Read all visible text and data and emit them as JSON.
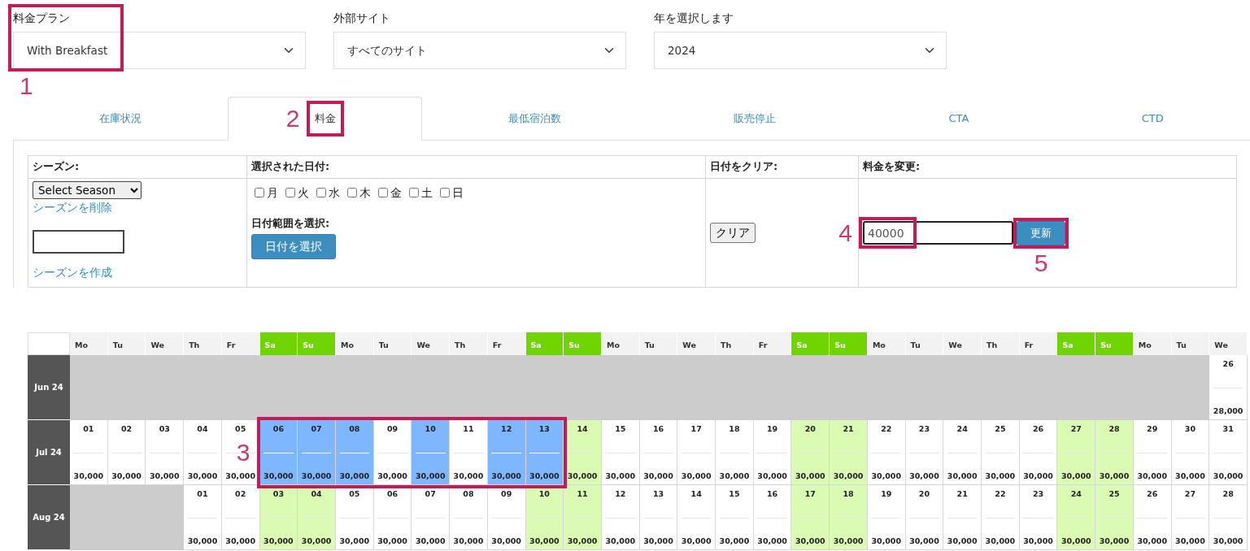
{
  "filters": [
    {
      "label": "料金プラン",
      "value": "With Breakfast"
    },
    {
      "label": "外部サイト",
      "value": "すべてのサイト"
    },
    {
      "label": "年を選択します",
      "value": "2024"
    }
  ],
  "tabs": [
    {
      "label": "在庫状況",
      "selected": false
    },
    {
      "label": "料金",
      "selected": true
    },
    {
      "label": "最低宿泊数",
      "selected": false
    },
    {
      "label": "販売停止",
      "selected": false
    },
    {
      "label": "CTA",
      "selected": false
    },
    {
      "label": "CTD",
      "selected": false
    }
  ],
  "season": {
    "heading": "シーズン:",
    "select": "Select Season",
    "delete_link": "シーズンを削除",
    "create_link": "シーズンを作成"
  },
  "dates": {
    "heading": "選択された日付:",
    "weekdays": [
      {
        "label": "月",
        "checked": false
      },
      {
        "label": "火",
        "checked": false
      },
      {
        "label": "水",
        "checked": false
      },
      {
        "label": "木",
        "checked": false
      },
      {
        "label": "金",
        "checked": false
      },
      {
        "label": "土",
        "checked": false
      },
      {
        "label": "日",
        "checked": false
      }
    ],
    "range_label": "日付範囲を選択:",
    "range_button": "日付を選択"
  },
  "clear": {
    "heading": "日付をクリア:",
    "button": "クリア"
  },
  "price": {
    "heading": "料金を変更:",
    "value": "40000",
    "button": "更新"
  },
  "calendar": {
    "weekdays": [
      {
        "label": "Mo",
        "weekend": false
      },
      {
        "label": "Tu",
        "weekend": false
      },
      {
        "label": "We",
        "weekend": false
      },
      {
        "label": "Th",
        "weekend": false
      },
      {
        "label": "Fr",
        "weekend": false
      },
      {
        "label": "Sa",
        "weekend": true
      },
      {
        "label": "Su",
        "weekend": true
      },
      {
        "label": "Mo",
        "weekend": false
      },
      {
        "label": "Tu",
        "weekend": false
      },
      {
        "label": "We",
        "weekend": false
      },
      {
        "label": "Th",
        "weekend": false
      },
      {
        "label": "Fr",
        "weekend": false
      },
      {
        "label": "Sa",
        "weekend": true
      },
      {
        "label": "Su",
        "weekend": true
      },
      {
        "label": "Mo",
        "weekend": false
      },
      {
        "label": "Tu",
        "weekend": false
      },
      {
        "label": "We",
        "weekend": false
      },
      {
        "label": "Th",
        "weekend": false
      },
      {
        "label": "Fr",
        "weekend": false
      },
      {
        "label": "Sa",
        "weekend": true
      },
      {
        "label": "Su",
        "weekend": true
      },
      {
        "label": "Mo",
        "weekend": false
      },
      {
        "label": "Tu",
        "weekend": false
      },
      {
        "label": "We",
        "weekend": false
      },
      {
        "label": "Th",
        "weekend": false
      },
      {
        "label": "Fr",
        "weekend": false
      },
      {
        "label": "Sa",
        "weekend": true
      },
      {
        "label": "Su",
        "weekend": true
      },
      {
        "label": "Mo",
        "weekend": false
      },
      {
        "label": "Tu",
        "weekend": false
      },
      {
        "label": "We",
        "weekend": false
      }
    ],
    "months": [
      {
        "label": "Jun 24",
        "cells": [
          {
            "kind": "blank"
          },
          {
            "kind": "blank"
          },
          {
            "kind": "blank"
          },
          {
            "kind": "blank"
          },
          {
            "kind": "blank"
          },
          {
            "kind": "blank"
          },
          {
            "kind": "blank"
          },
          {
            "kind": "blank"
          },
          {
            "kind": "blank"
          },
          {
            "kind": "blank"
          },
          {
            "kind": "blank"
          },
          {
            "kind": "blank"
          },
          {
            "kind": "blank"
          },
          {
            "kind": "blank"
          },
          {
            "kind": "blank"
          },
          {
            "kind": "blank"
          },
          {
            "kind": "blank"
          },
          {
            "kind": "blank"
          },
          {
            "kind": "blank"
          },
          {
            "kind": "blank"
          },
          {
            "kind": "blank"
          },
          {
            "kind": "blank"
          },
          {
            "kind": "blank"
          },
          {
            "kind": "blank"
          },
          {
            "kind": "blank"
          },
          {
            "kind": "blank"
          },
          {
            "kind": "blank"
          },
          {
            "kind": "blank"
          },
          {
            "kind": "blank"
          },
          {
            "kind": "blank"
          },
          {
            "kind": "day",
            "day": "26",
            "price": "28,000",
            "weekend": false,
            "selected": false
          }
        ]
      },
      {
        "label": "Jul 24",
        "cells": [
          {
            "kind": "day",
            "day": "01",
            "price": "30,000",
            "weekend": false,
            "selected": false
          },
          {
            "kind": "day",
            "day": "02",
            "price": "30,000",
            "weekend": false,
            "selected": false
          },
          {
            "kind": "day",
            "day": "03",
            "price": "30,000",
            "weekend": false,
            "selected": false
          },
          {
            "kind": "day",
            "day": "04",
            "price": "30,000",
            "weekend": false,
            "selected": false
          },
          {
            "kind": "day",
            "day": "05",
            "price": "30,000",
            "weekend": false,
            "selected": false
          },
          {
            "kind": "day",
            "day": "06",
            "price": "30,000",
            "weekend": true,
            "selected": true
          },
          {
            "kind": "day",
            "day": "07",
            "price": "30,000",
            "weekend": true,
            "selected": true
          },
          {
            "kind": "day",
            "day": "08",
            "price": "30,000",
            "weekend": false,
            "selected": true
          },
          {
            "kind": "day",
            "day": "09",
            "price": "30,000",
            "weekend": false,
            "selected": false
          },
          {
            "kind": "day",
            "day": "10",
            "price": "30,000",
            "weekend": false,
            "selected": true
          },
          {
            "kind": "day",
            "day": "11",
            "price": "30,000",
            "weekend": false,
            "selected": false
          },
          {
            "kind": "day",
            "day": "12",
            "price": "30,000",
            "weekend": false,
            "selected": true
          },
          {
            "kind": "day",
            "day": "13",
            "price": "30,000",
            "weekend": true,
            "selected": true
          },
          {
            "kind": "day",
            "day": "14",
            "price": "30,000",
            "weekend": true,
            "selected": false
          },
          {
            "kind": "day",
            "day": "15",
            "price": "30,000",
            "weekend": false,
            "selected": false
          },
          {
            "kind": "day",
            "day": "16",
            "price": "30,000",
            "weekend": false,
            "selected": false
          },
          {
            "kind": "day",
            "day": "17",
            "price": "30,000",
            "weekend": false,
            "selected": false
          },
          {
            "kind": "day",
            "day": "18",
            "price": "30,000",
            "weekend": false,
            "selected": false
          },
          {
            "kind": "day",
            "day": "19",
            "price": "30,000",
            "weekend": false,
            "selected": false
          },
          {
            "kind": "day",
            "day": "20",
            "price": "30,000",
            "weekend": true,
            "selected": false
          },
          {
            "kind": "day",
            "day": "21",
            "price": "30,000",
            "weekend": true,
            "selected": false
          },
          {
            "kind": "day",
            "day": "22",
            "price": "30,000",
            "weekend": false,
            "selected": false
          },
          {
            "kind": "day",
            "day": "23",
            "price": "30,000",
            "weekend": false,
            "selected": false
          },
          {
            "kind": "day",
            "day": "24",
            "price": "30,000",
            "weekend": false,
            "selected": false
          },
          {
            "kind": "day",
            "day": "25",
            "price": "30,000",
            "weekend": false,
            "selected": false
          },
          {
            "kind": "day",
            "day": "26",
            "price": "30,000",
            "weekend": false,
            "selected": false
          },
          {
            "kind": "day",
            "day": "27",
            "price": "30,000",
            "weekend": true,
            "selected": false
          },
          {
            "kind": "day",
            "day": "28",
            "price": "30,000",
            "weekend": true,
            "selected": false
          },
          {
            "kind": "day",
            "day": "29",
            "price": "30,000",
            "weekend": false,
            "selected": false
          },
          {
            "kind": "day",
            "day": "30",
            "price": "30,000",
            "weekend": false,
            "selected": false
          },
          {
            "kind": "day",
            "day": "31",
            "price": "30,000",
            "weekend": false,
            "selected": false
          }
        ]
      },
      {
        "label": "Aug 24",
        "cells": [
          {
            "kind": "blank"
          },
          {
            "kind": "blank"
          },
          {
            "kind": "blank"
          },
          {
            "kind": "day",
            "day": "01",
            "price": "30,000",
            "weekend": false,
            "selected": false
          },
          {
            "kind": "day",
            "day": "02",
            "price": "30,000",
            "weekend": false,
            "selected": false
          },
          {
            "kind": "day",
            "day": "03",
            "price": "30,000",
            "weekend": true,
            "selected": false
          },
          {
            "kind": "day",
            "day": "04",
            "price": "30,000",
            "weekend": true,
            "selected": false
          },
          {
            "kind": "day",
            "day": "05",
            "price": "30,000",
            "weekend": false,
            "selected": false
          },
          {
            "kind": "day",
            "day": "06",
            "price": "30,000",
            "weekend": false,
            "selected": false
          },
          {
            "kind": "day",
            "day": "07",
            "price": "30,000",
            "weekend": false,
            "selected": false
          },
          {
            "kind": "day",
            "day": "08",
            "price": "30,000",
            "weekend": false,
            "selected": false
          },
          {
            "kind": "day",
            "day": "09",
            "price": "30,000",
            "weekend": false,
            "selected": false
          },
          {
            "kind": "day",
            "day": "10",
            "price": "30,000",
            "weekend": true,
            "selected": false
          },
          {
            "kind": "day",
            "day": "11",
            "price": "30,000",
            "weekend": true,
            "selected": false
          },
          {
            "kind": "day",
            "day": "12",
            "price": "30,000",
            "weekend": false,
            "selected": false
          },
          {
            "kind": "day",
            "day": "13",
            "price": "30,000",
            "weekend": false,
            "selected": false
          },
          {
            "kind": "day",
            "day": "14",
            "price": "30,000",
            "weekend": false,
            "selected": false
          },
          {
            "kind": "day",
            "day": "15",
            "price": "30,000",
            "weekend": false,
            "selected": false
          },
          {
            "kind": "day",
            "day": "16",
            "price": "30,000",
            "weekend": false,
            "selected": false
          },
          {
            "kind": "day",
            "day": "17",
            "price": "30,000",
            "weekend": true,
            "selected": false
          },
          {
            "kind": "day",
            "day": "18",
            "price": "30,000",
            "weekend": true,
            "selected": false
          },
          {
            "kind": "day",
            "day": "19",
            "price": "30,000",
            "weekend": false,
            "selected": false
          },
          {
            "kind": "day",
            "day": "20",
            "price": "30,000",
            "weekend": false,
            "selected": false
          },
          {
            "kind": "day",
            "day": "21",
            "price": "30,000",
            "weekend": false,
            "selected": false
          },
          {
            "kind": "day",
            "day": "22",
            "price": "30,000",
            "weekend": false,
            "selected": false
          },
          {
            "kind": "day",
            "day": "23",
            "price": "30,000",
            "weekend": false,
            "selected": false
          },
          {
            "kind": "day",
            "day": "24",
            "price": "30,000",
            "weekend": true,
            "selected": false
          },
          {
            "kind": "day",
            "day": "25",
            "price": "30,000",
            "weekend": true,
            "selected": false
          },
          {
            "kind": "day",
            "day": "26",
            "price": "30,000",
            "weekend": false,
            "selected": false
          },
          {
            "kind": "day",
            "day": "27",
            "price": "30,000",
            "weekend": false,
            "selected": false
          },
          {
            "kind": "day",
            "day": "28",
            "price": "30,000",
            "weekend": false,
            "selected": false
          }
        ]
      }
    ]
  },
  "annotations": [
    {
      "label": "1"
    },
    {
      "label": "2"
    },
    {
      "label": "3"
    },
    {
      "label": "4"
    },
    {
      "label": "5"
    }
  ]
}
